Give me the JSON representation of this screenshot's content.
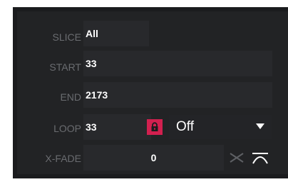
{
  "fields": {
    "slice": {
      "label": "SLICE",
      "value": "All"
    },
    "start": {
      "label": "START",
      "value": "33"
    },
    "end": {
      "label": "END",
      "value": "2173"
    },
    "loop": {
      "label": "LOOP",
      "value": "33"
    },
    "xfade": {
      "label": "X-FADE",
      "value": "0"
    }
  },
  "loop_mode": {
    "selected": "Off"
  },
  "colors": {
    "accent": "#d2204f",
    "panel": "#222325",
    "field": "#28292c"
  },
  "icons": [
    "lock-icon",
    "dropdown-arrow-icon",
    "xfade-linear-icon",
    "xfade-curve-icon"
  ]
}
